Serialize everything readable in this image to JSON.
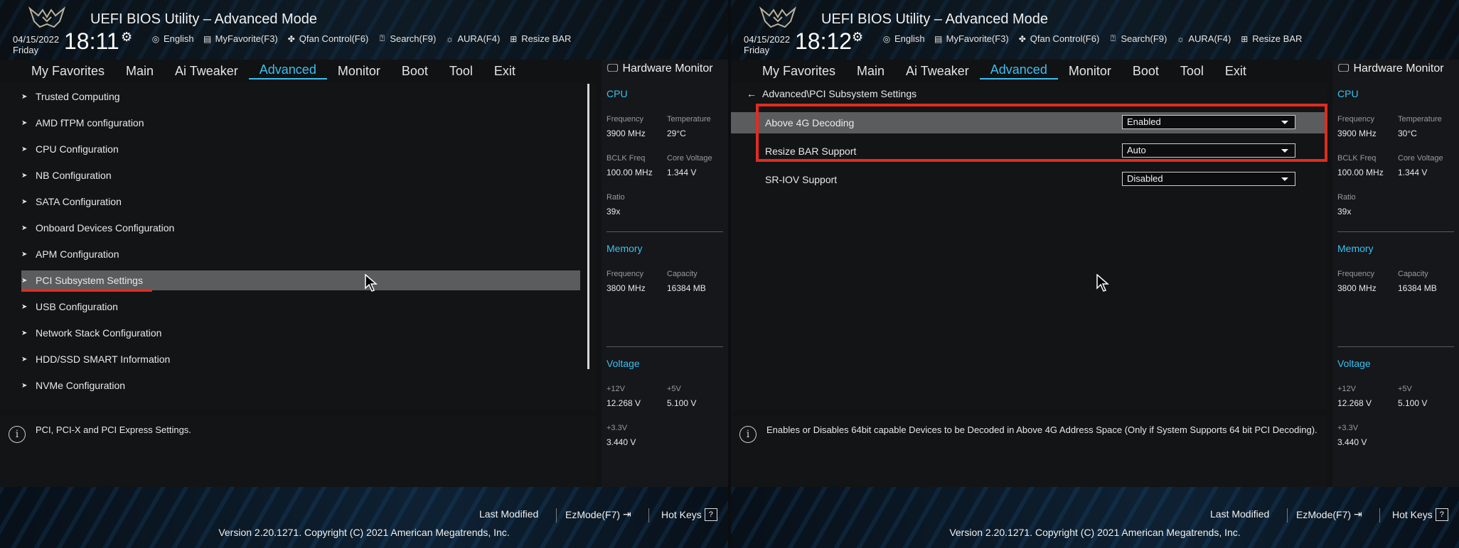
{
  "left": {
    "app_title": "UEFI BIOS Utility – Advanced Mode",
    "date": "04/15/2022",
    "day": "Friday",
    "time": "18:11",
    "toolbar": [
      {
        "icon": "globe-icon",
        "label": "English"
      },
      {
        "icon": "favorite-icon",
        "label": "MyFavorite(F3)"
      },
      {
        "icon": "fan-icon",
        "label": "Qfan Control(F6)"
      },
      {
        "icon": "search-icon",
        "label": "Search(F9)"
      },
      {
        "icon": "aura-icon",
        "label": "AURA(F4)"
      },
      {
        "icon": "resize-bar-icon",
        "label": "Resize BAR"
      }
    ],
    "menu": [
      "My Favorites",
      "Main",
      "Ai Tweaker",
      "Advanced",
      "Monitor",
      "Boot",
      "Tool",
      "Exit"
    ],
    "active_menu": "Advanced",
    "items": [
      "Trusted Computing",
      "AMD fTPM configuration",
      "CPU Configuration",
      "NB Configuration",
      "SATA Configuration",
      "Onboard Devices Configuration",
      "APM Configuration",
      "PCI Subsystem Settings",
      "USB Configuration",
      "Network Stack Configuration",
      "HDD/SSD SMART Information",
      "NVMe Configuration"
    ],
    "selected_item": "PCI Subsystem Settings",
    "help_text": "PCI, PCI-X and PCI Express Settings.",
    "hw": {
      "title": "Hardware Monitor",
      "cpu_label": "CPU",
      "freq_label": "Frequency",
      "freq": "3900 MHz",
      "temp_label": "Temperature",
      "temp": "29°C",
      "bclk_label": "BCLK Freq",
      "bclk": "100.00 MHz",
      "cv_label": "Core Voltage",
      "cv": "1.344 V",
      "ratio_label": "Ratio",
      "ratio": "39x",
      "mem_label": "Memory",
      "mfreq_label": "Frequency",
      "mfreq": "3800 MHz",
      "cap_label": "Capacity",
      "cap": "16384 MB",
      "volt_label": "Voltage",
      "v12_label": "+12V",
      "v12": "12.268 V",
      "v5_label": "+5V",
      "v5": "5.100 V",
      "v33_label": "+3.3V",
      "v33": "3.440 V"
    },
    "footer": {
      "last_modified": "Last Modified",
      "ezmode": "EzMode(F7)",
      "hotkeys": "Hot Keys",
      "version": "Version 2.20.1271. Copyright (C) 2021 American Megatrends, Inc."
    }
  },
  "right": {
    "app_title": "UEFI BIOS Utility – Advanced Mode",
    "date": "04/15/2022",
    "day": "Friday",
    "time": "18:12",
    "toolbar": [
      {
        "icon": "globe-icon",
        "label": "English"
      },
      {
        "icon": "favorite-icon",
        "label": "MyFavorite(F3)"
      },
      {
        "icon": "fan-icon",
        "label": "Qfan Control(F6)"
      },
      {
        "icon": "search-icon",
        "label": "Search(F9)"
      },
      {
        "icon": "aura-icon",
        "label": "AURA(F4)"
      },
      {
        "icon": "resize-bar-icon",
        "label": "Resize BAR"
      }
    ],
    "menu": [
      "My Favorites",
      "Main",
      "Ai Tweaker",
      "Advanced",
      "Monitor",
      "Boot",
      "Tool",
      "Exit"
    ],
    "active_menu": "Advanced",
    "breadcrumb": "Advanced\\PCI Subsystem Settings",
    "settings": [
      {
        "name": "Above 4G Decoding",
        "value": "Enabled"
      },
      {
        "name": "Resize BAR Support",
        "value": "Auto"
      },
      {
        "name": "SR-IOV Support",
        "value": "Disabled"
      }
    ],
    "help_text": "Enables or Disables 64bit capable Devices to be Decoded in Above 4G Address Space (Only if System Supports 64 bit PCI Decoding).",
    "hw": {
      "title": "Hardware Monitor",
      "cpu_label": "CPU",
      "freq_label": "Frequency",
      "freq": "3900 MHz",
      "temp_label": "Temperature",
      "temp": "30°C",
      "bclk_label": "BCLK Freq",
      "bclk": "100.00 MHz",
      "cv_label": "Core Voltage",
      "cv": "1.344 V",
      "ratio_label": "Ratio",
      "ratio": "39x",
      "mem_label": "Memory",
      "mfreq_label": "Frequency",
      "mfreq": "3800 MHz",
      "cap_label": "Capacity",
      "cap": "16384 MB",
      "volt_label": "Voltage",
      "v12_label": "+12V",
      "v12": "12.268 V",
      "v5_label": "+5V",
      "v5": "5.100 V",
      "v33_label": "+3.3V",
      "v33": "3.440 V"
    },
    "footer": {
      "last_modified": "Last Modified",
      "ezmode": "EzMode(F7)",
      "hotkeys": "Hot Keys",
      "version": "Version 2.20.1271. Copyright (C) 2021 American Megatrends, Inc."
    }
  },
  "colors": {
    "accent": "#3ac0f0",
    "highlight_red": "#e22b1f",
    "selected_row": "#5a5c5e"
  }
}
